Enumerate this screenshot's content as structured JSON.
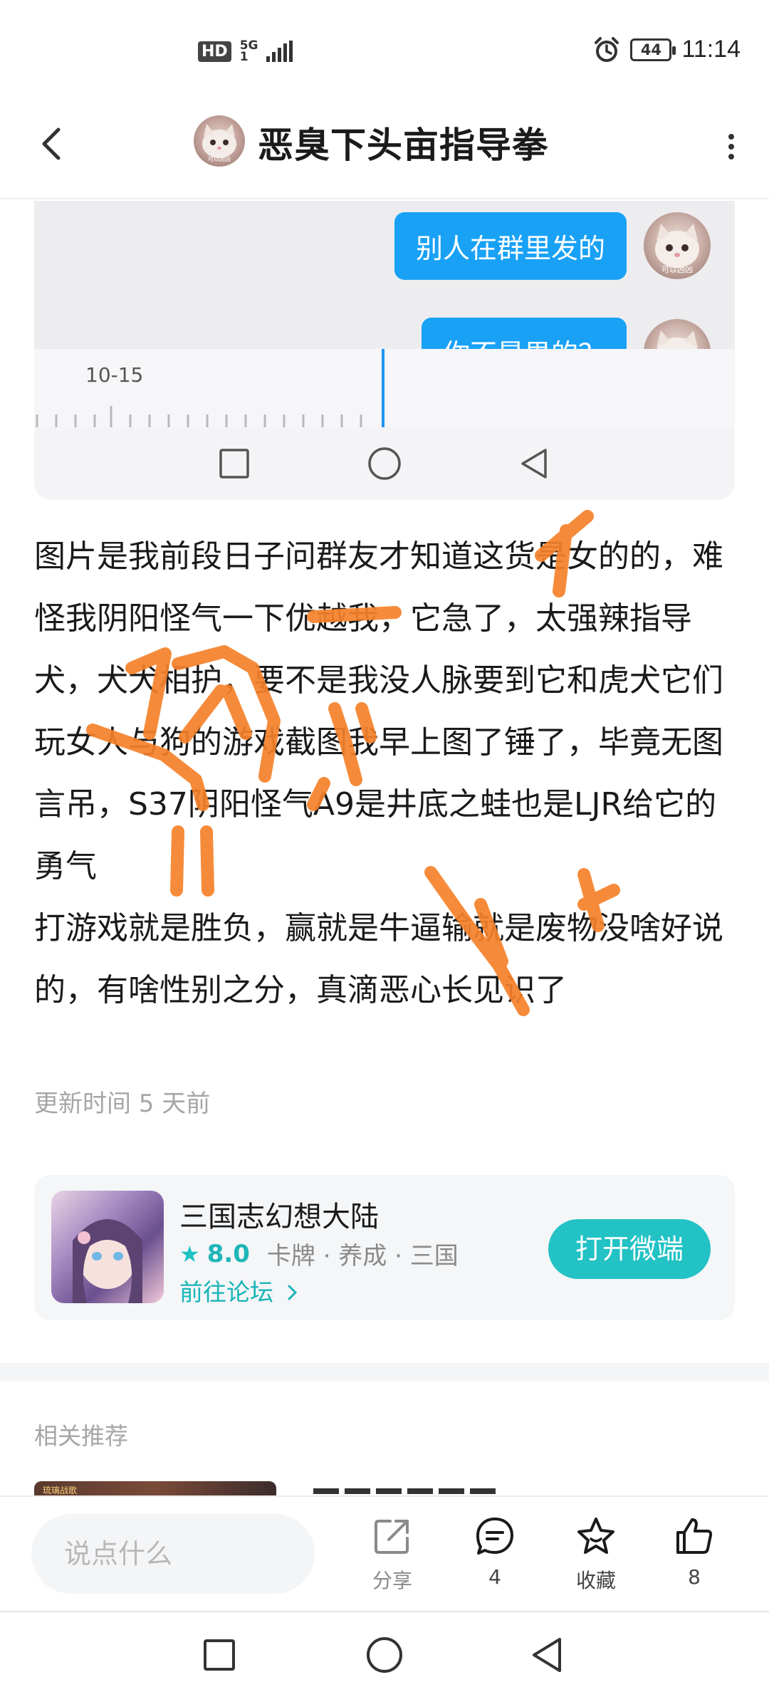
{
  "status_bar": {
    "hd": "HD",
    "network": "5G",
    "network_sub": "1",
    "battery": "44",
    "time": "11:14"
  },
  "header": {
    "title": "恶臭下头亩指导拳",
    "avatar_caption": "可以凶凶"
  },
  "embedded_screenshot": {
    "bubbles": [
      "别人在群里发的",
      "你不是男的？"
    ],
    "avatar_caption": "可以凶凶",
    "timeline_date": "10-15"
  },
  "post": {
    "paragraphs": [
      "图片是我前段日子问群友才知道这货是女的的，难怪我阴阳怪气一下优越我，它急了，太强辣指导犬，犬犬相护，要不是我没人脉要到它和虎犬它们玩女人与狗的游戏截图我早上图了锤了，毕竟无图言吊，S37阴阳怪气A9是井底之蛙也是LJR给它的勇气",
      "打游戏就是胜负，赢就是牛逼输就是废物没啥好说的，有啥性别之分，真滴恶心长见识了"
    ],
    "updated": "更新时间 5 天前"
  },
  "game_card": {
    "name": "三国志幻想大陆",
    "rating": "8.0",
    "tags": "卡牌 · 养成 · 三国",
    "forum_link": "前往论坛",
    "open_button": "打开微端"
  },
  "related": {
    "heading": "相关推荐",
    "thumb_text": "琉璃战歌"
  },
  "action_bar": {
    "input_placeholder": "说点什么",
    "share_label": "分享",
    "comment_count": "4",
    "favorite_label": "收藏",
    "like_count": "8"
  },
  "colors": {
    "accent": "#22c2c5",
    "bubble": "#19a1f6",
    "scribble": "#f5822a"
  },
  "icons": [
    "back-arrow-icon",
    "more-vertical-icon",
    "star-icon",
    "chevron-right-icon",
    "share-icon",
    "comment-icon",
    "favorite-star-icon",
    "thumbs-up-icon",
    "square-nav-icon",
    "circle-nav-icon",
    "triangle-back-nav-icon"
  ]
}
